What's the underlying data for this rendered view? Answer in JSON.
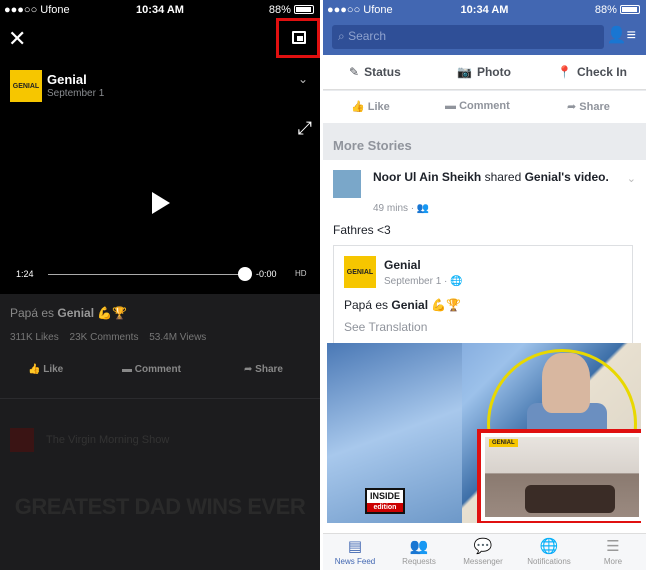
{
  "left": {
    "status": {
      "carrier": "●●●○○ Ufone",
      "time": "10:34 AM",
      "battery": "88%"
    },
    "close_icon": "✕",
    "page": {
      "name": "Genial",
      "date": "September 1",
      "logo_text": "GENIAL"
    },
    "video": {
      "current_time": "1:24",
      "remaining_time": "-0:00",
      "quality": "HD",
      "progress": 1.0
    },
    "post": {
      "title_prefix": "Papá es ",
      "title_bold": "Genial",
      "title_emoji": " 💪🏆",
      "likes": "311K Likes",
      "comments": "23K Comments",
      "views": "53.4M Views"
    },
    "actions": {
      "like": "Like",
      "comment": "Comment",
      "share": "Share"
    },
    "up_next": "The Virgin Morning Show",
    "overlay_text": "GREATEST DAD WINS EVER"
  },
  "right": {
    "status": {
      "carrier": "●●●○○ Ufone",
      "time": "10:34 AM",
      "battery": "88%"
    },
    "search": {
      "placeholder": "Search"
    },
    "composer": {
      "status": "Status",
      "photo": "Photo",
      "checkin": "Check In"
    },
    "actions": {
      "like": "Like",
      "comment": "Comment",
      "share": "Share"
    },
    "section_title": "More Stories",
    "post": {
      "author": "Noor Ul Ain Sheikh",
      "shared_text": " shared ",
      "page": "Genial",
      "suffix": "'s video.",
      "time": "49 mins",
      "text": "Fathres <3",
      "shared": {
        "name": "Genial",
        "date": "September 1 · ",
        "logo_text": "GENIAL",
        "title_prefix": "Papá es ",
        "title_bold": "Genial",
        "title_emoji": " 💪🏆",
        "see_translation": "See Translation"
      },
      "video_brand": "INSIDE",
      "video_brand_sub": "edition",
      "mini_badge": "GENIAL"
    },
    "tabs": [
      {
        "label": "News Feed",
        "icon": "▤"
      },
      {
        "label": "Requests",
        "icon": "👥"
      },
      {
        "label": "Messenger",
        "icon": "💬"
      },
      {
        "label": "Notifications",
        "icon": "🌐"
      },
      {
        "label": "More",
        "icon": "☰"
      }
    ]
  },
  "colors": {
    "facebook_blue": "#4267b2",
    "highlight_red": "#e01010",
    "genial_yellow": "#f6c600"
  }
}
